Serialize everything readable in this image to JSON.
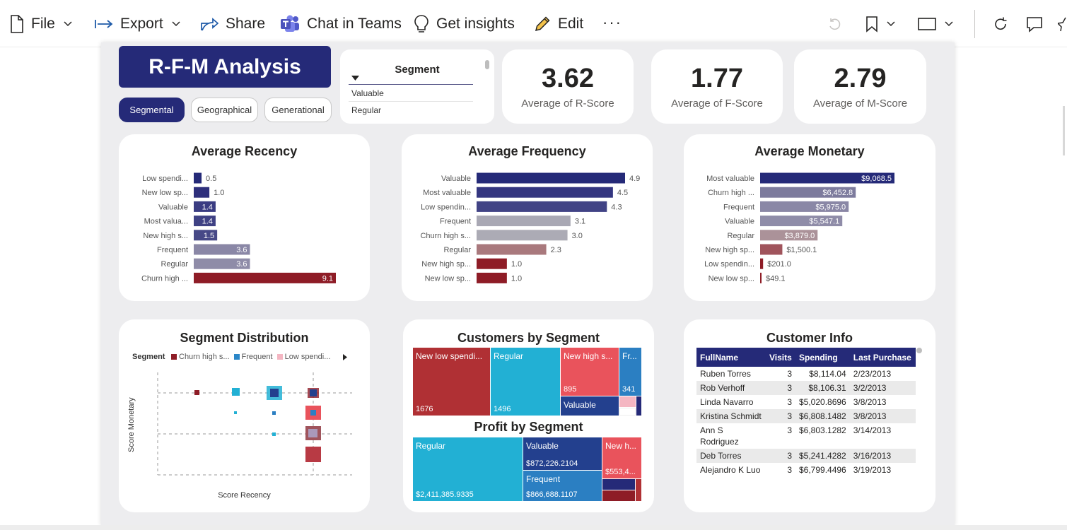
{
  "toolbar": {
    "file": "File",
    "export": "Export",
    "share": "Share",
    "chat_in_teams": "Chat in Teams",
    "get_insights": "Get insights",
    "edit": "Edit",
    "more": "···"
  },
  "report": {
    "title": "R-F-M Analysis",
    "tabs": [
      "Segmental",
      "Geographical",
      "Generational"
    ],
    "active_tab": "Segmental",
    "slicer": {
      "header": "Segment",
      "items": [
        "Valuable",
        "Regular"
      ]
    },
    "kpis": [
      {
        "value": "3.62",
        "label": "Average of R-Score"
      },
      {
        "value": "1.77",
        "label": "Average of F-Score"
      },
      {
        "value": "2.79",
        "label": "Average of M-Score"
      }
    ],
    "colors": {
      "navy": "#252a78",
      "dark_red": "#8e1c26",
      "grey_purple": "#8a87a6",
      "medium_blue": "#474987"
    }
  },
  "chart_data": [
    {
      "type": "bar",
      "title": "Average Recency",
      "categories": [
        "Low spendi...",
        "New low sp...",
        "Valuable",
        "Most valua...",
        "New high s...",
        "Frequent",
        "Regular",
        "Churn high ..."
      ],
      "values": [
        0.5,
        1.0,
        1.4,
        1.4,
        1.5,
        3.6,
        3.6,
        9.1
      ],
      "value_labels": [
        "0.5",
        "1.0",
        "1.4",
        "1.4",
        "1.5",
        "3.6",
        "3.6",
        "9.1"
      ],
      "colors": [
        "#252a78",
        "#2e2f7c",
        "#3a3c82",
        "#3f4184",
        "#474987",
        "#8a87a6",
        "#8f8ca8",
        "#8e1c26"
      ],
      "max": 9.1
    },
    {
      "type": "bar",
      "title": "Average Frequency",
      "categories": [
        "Valuable",
        "Most valuable",
        "Low spendin...",
        "Frequent",
        "Churn high s...",
        "Regular",
        "New high sp...",
        "New low sp..."
      ],
      "values": [
        4.9,
        4.5,
        4.3,
        3.1,
        3.0,
        2.3,
        1.0,
        1.0
      ],
      "value_labels": [
        "4.9",
        "4.5",
        "4.3",
        "3.1",
        "3.0",
        "2.3",
        "1.0",
        "1.0"
      ],
      "colors": [
        "#252a78",
        "#343680",
        "#414385",
        "#a9a8b4",
        "#acabb5",
        "#a9797d",
        "#8e1c26",
        "#8e1c26"
      ],
      "max": 4.9
    },
    {
      "type": "bar",
      "title": "Average Monetary",
      "categories": [
        "Most valuable",
        "Churn high ...",
        "Frequent",
        "Valuable",
        "Regular",
        "New high sp...",
        "Low spendin...",
        "New low sp..."
      ],
      "values": [
        9068.5,
        6452.8,
        5975.0,
        5547.1,
        3879.0,
        1500.1,
        201.0,
        49.1
      ],
      "value_labels": [
        "$9,068.5",
        "$6,452.8",
        "$5,975.0",
        "$5,547.1",
        "$3,879.0",
        "$1,500.1",
        "$201.0",
        "$49.1"
      ],
      "colors": [
        "#252a78",
        "#7d7b9d",
        "#8a87a6",
        "#8f8ca8",
        "#ab9299",
        "#a0545c",
        "#8e1c26",
        "#8e1c26"
      ],
      "max": 9068.5
    },
    {
      "type": "scatter",
      "title": "Segment Distribution",
      "legend_title": "Segment",
      "legend": [
        {
          "name": "Churn high s...",
          "color": "#8e1c26"
        },
        {
          "name": "Frequent",
          "color": "#2b87c8"
        },
        {
          "name": "Low spendi...",
          "color": "#f4b6c2"
        }
      ],
      "xlabel": "Score Recency",
      "ylabel": "Score Monetary",
      "grid": true
    },
    {
      "type": "treemap",
      "title": "Customers by Segment",
      "cells": [
        {
          "label": "New low spendi...",
          "value": "1676",
          "color": "#b03034"
        },
        {
          "label": "Regular",
          "value": "1496",
          "color": "#22b0d4"
        },
        {
          "label": "New high s...",
          "value": "895",
          "color": "#e9535c"
        },
        {
          "label": "Fr...",
          "value": "341",
          "color": "#2b7fc2"
        },
        {
          "label": "Valuable",
          "value": "",
          "color": "#23408e"
        }
      ]
    },
    {
      "type": "treemap",
      "title": "Profit by Segment",
      "cells": [
        {
          "label": "Regular",
          "value": "$2,411,385.9335",
          "color": "#22b0d4"
        },
        {
          "label": "Valuable",
          "value": "$872,226.2104",
          "color": "#23408e"
        },
        {
          "label": "New h...",
          "value": "$553,4...",
          "color": "#e9535c"
        },
        {
          "label": "Frequent",
          "value": "$866,688.1107",
          "color": "#2b7fc2"
        }
      ]
    },
    {
      "type": "table",
      "title": "Customer Info",
      "columns": [
        "FullName",
        "Visits",
        "Spending",
        "Last Purchase"
      ],
      "rows": [
        [
          "Ruben Torres",
          "3",
          "$8,114.04",
          "2/23/2013"
        ],
        [
          "Rob Verhoff",
          "3",
          "$8,106.31",
          "3/2/2013"
        ],
        [
          "Linda Navarro",
          "3",
          "$5,020.8696",
          "3/8/2013"
        ],
        [
          "Kristina Schmidt",
          "3",
          "$6,808.1482",
          "3/8/2013"
        ],
        [
          "Ann S Rodriguez",
          "3",
          "$6,803.1282",
          "3/14/2013"
        ],
        [
          "Deb Torres",
          "3",
          "$5,241.4282",
          "3/16/2013"
        ],
        [
          "Alejandro K Luo",
          "3",
          "$6,799.4496",
          "3/19/2013"
        ]
      ]
    }
  ]
}
